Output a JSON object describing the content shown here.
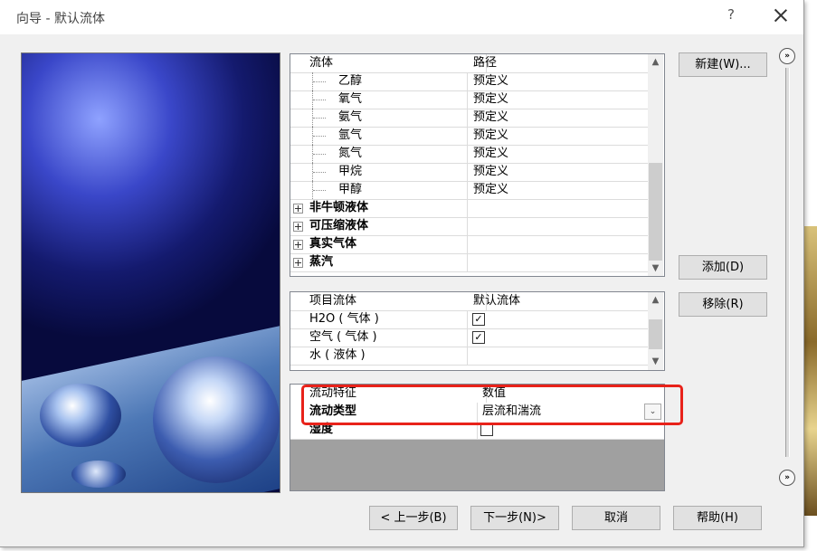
{
  "window": {
    "title": "向导 - 默认流体",
    "help_glyph": "?"
  },
  "fluids_grid": {
    "headers": [
      "流体",
      "路径"
    ],
    "items": [
      {
        "name": "乙醇",
        "path": "预定义"
      },
      {
        "name": "氧气",
        "path": "预定义"
      },
      {
        "name": "氨气",
        "path": "预定义"
      },
      {
        "name": "氩气",
        "path": "预定义"
      },
      {
        "name": "氮气",
        "path": "预定义"
      },
      {
        "name": "甲烷",
        "path": "预定义"
      },
      {
        "name": "甲醇",
        "path": "预定义"
      }
    ],
    "groups": [
      "非牛顿液体",
      "可压缩液体",
      "真实气体",
      "蒸汽"
    ]
  },
  "project_grid": {
    "headers": [
      "项目流体",
      "默认流体"
    ],
    "rows": [
      {
        "name": "H2O ( 气体 )",
        "default": true
      },
      {
        "name": "空气 ( 气体 )",
        "default": true
      },
      {
        "name": "水 ( 液体 )",
        "default": false
      }
    ]
  },
  "flow_grid": {
    "headers": [
      "流动特征",
      "数值"
    ],
    "flow_type_label": "流动类型",
    "flow_type_value": "层流和湍流",
    "humidity_label": "湿度"
  },
  "side_buttons": {
    "new": "新建(W)...",
    "add": "添加(D)",
    "remove": "移除(R)"
  },
  "nav_buttons": {
    "back": "< 上一步(B)",
    "next": "下一步(N)>",
    "cancel": "取消",
    "help": "帮助(H)"
  },
  "icons": {
    "expand_up": "double-chevron-up-icon",
    "expand_down": "double-chevron-down-icon",
    "check": "✓"
  },
  "colors": {
    "highlight": "#e8221a",
    "dialog_bg": "#f0f0f0"
  }
}
